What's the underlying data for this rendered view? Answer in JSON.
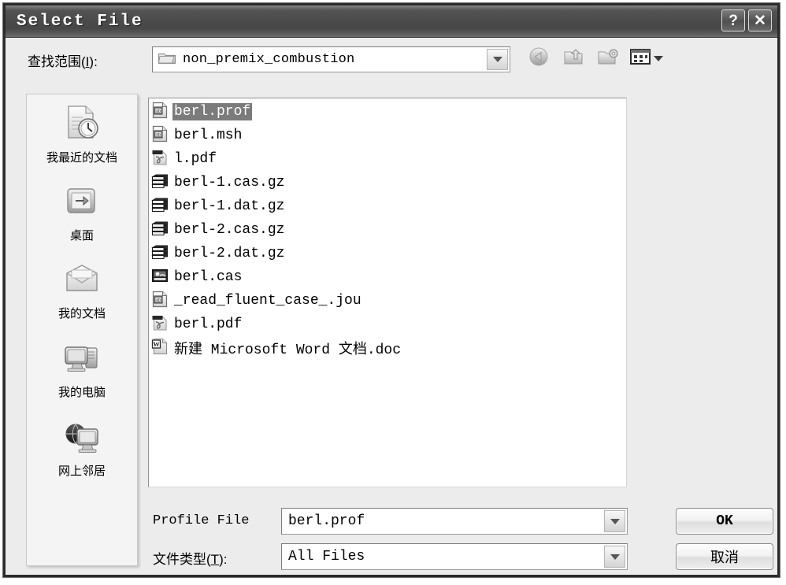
{
  "window": {
    "title": "Select File",
    "help_button": "?",
    "close_button": "✕"
  },
  "lookin": {
    "label_prefix": "查找范围(",
    "label_mnemonic": "I",
    "label_suffix": "):",
    "value": "non_premix_combustion",
    "icon": "folder-icon"
  },
  "toolbar": {
    "back": "back-icon",
    "up_one_level": "up-one-level-icon",
    "new_folder": "new-folder-icon",
    "views": "views-icon"
  },
  "places": [
    {
      "label": "我最近的文档",
      "icon": "recent-documents-icon"
    },
    {
      "label": "桌面",
      "icon": "desktop-icon"
    },
    {
      "label": "我的文档",
      "icon": "my-documents-icon"
    },
    {
      "label": "我的电脑",
      "icon": "my-computer-icon"
    },
    {
      "label": "网上邻居",
      "icon": "network-places-icon"
    }
  ],
  "files": [
    {
      "name": "berl.prof",
      "icon": "text-file-icon",
      "selected": true
    },
    {
      "name": "berl.msh",
      "icon": "text-file-icon",
      "selected": false
    },
    {
      "name": "l.pdf",
      "icon": "pdf-file-icon",
      "selected": false
    },
    {
      "name": "berl-1.cas.gz",
      "icon": "archive-file-icon",
      "selected": false
    },
    {
      "name": "berl-1.dat.gz",
      "icon": "archive-file-icon",
      "selected": false
    },
    {
      "name": "berl-2.cas.gz",
      "icon": "archive-file-icon",
      "selected": false
    },
    {
      "name": "berl-2.dat.gz",
      "icon": "archive-file-icon",
      "selected": false
    },
    {
      "name": "berl.cas",
      "icon": "binary-file-icon",
      "selected": false
    },
    {
      "name": "_read_fluent_case_.jou",
      "icon": "text-file-icon",
      "selected": false
    },
    {
      "name": "berl.pdf",
      "icon": "pdf-file-icon",
      "selected": false
    },
    {
      "name": "新建 Microsoft Word 文档.doc",
      "icon": "word-file-icon",
      "selected": false
    }
  ],
  "fields": {
    "profile_label": "Profile File",
    "profile_value": "berl.prof",
    "filetype_label_prefix": "文件类型(",
    "filetype_label_mnemonic": "T",
    "filetype_label_suffix": "):",
    "filetype_value": "All Files"
  },
  "buttons": {
    "ok": "OK",
    "cancel": "取消"
  },
  "colors": {
    "titlebar_dark": "#4b4b4b",
    "dialog_face": "#ececec",
    "selection": "#7b7b7b",
    "list_background": "#ffffff"
  }
}
